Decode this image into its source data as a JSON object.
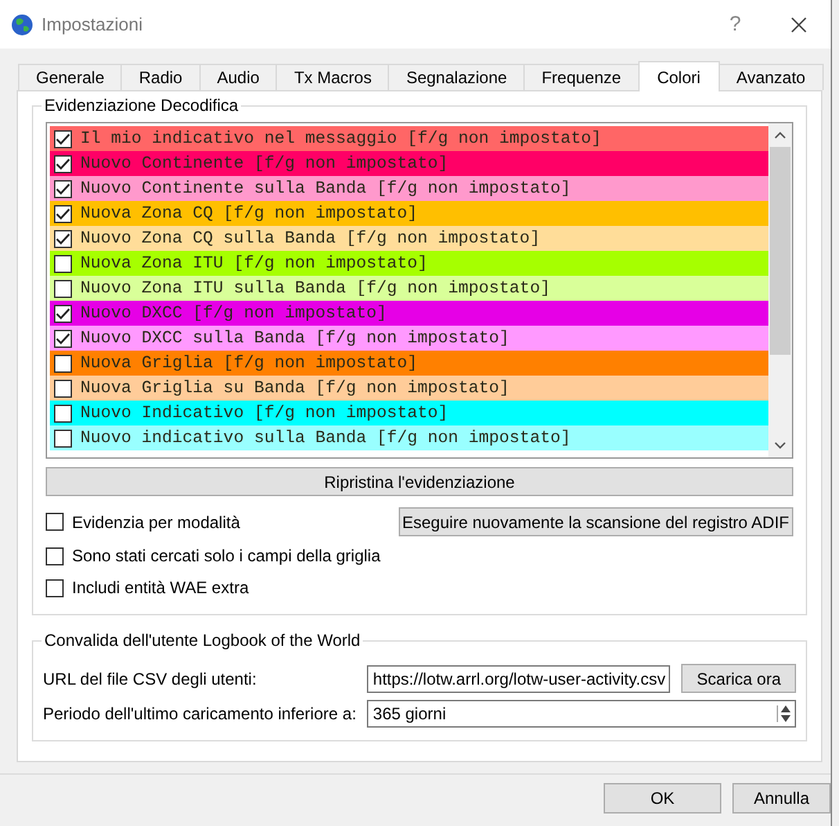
{
  "window": {
    "title": "Impostazioni",
    "help": "?"
  },
  "tabs": [
    {
      "label": "Generale",
      "selected": false
    },
    {
      "label": "Radio",
      "selected": false
    },
    {
      "label": "Audio",
      "selected": false
    },
    {
      "label": "Tx Macros",
      "selected": false
    },
    {
      "label": "Segnalazione",
      "selected": false
    },
    {
      "label": "Frequenze",
      "selected": false
    },
    {
      "label": "Colori",
      "selected": true
    },
    {
      "label": "Avanzato",
      "selected": false
    }
  ],
  "highlight": {
    "title": "Evidenziazione Decodifica",
    "rows": [
      {
        "label": "Il mio indicativo nel messaggio [f/g non impostato]",
        "checked": true,
        "color": "#ff6666"
      },
      {
        "label": "Nuovo Continente [f/g non impostato]",
        "checked": true,
        "color": "#ff0066"
      },
      {
        "label": "Nuovo Continente sulla Banda [f/g non impostato]",
        "checked": true,
        "color": "#ff99cc"
      },
      {
        "label": "Nuova Zona CQ [f/g non impostato]",
        "checked": true,
        "color": "#ffbf00"
      },
      {
        "label": "Nuovo Zona CQ sulla Banda [f/g non impostato]",
        "checked": true,
        "color": "#ffdd99"
      },
      {
        "label": "Nuova Zona ITU [f/g non impostato]",
        "checked": false,
        "color": "#a6ff00"
      },
      {
        "label": "Nuovo Zona ITU sulla Banda [f/g non impostato]",
        "checked": false,
        "color": "#d9ff99"
      },
      {
        "label": "Nuovo DXCC [f/g non impostato]",
        "checked": true,
        "color": "#e600e6"
      },
      {
        "label": "Nuovo DXCC sulla Banda [f/g non impostato]",
        "checked": true,
        "color": "#ff99ff"
      },
      {
        "label": "Nuova Griglia [f/g non impostato]",
        "checked": false,
        "color": "#ff8000"
      },
      {
        "label": "Nuova Griglia su Banda [f/g non impostato]",
        "checked": false,
        "color": "#ffcc99"
      },
      {
        "label": "Nuovo Indicativo [f/g non impostato]",
        "checked": false,
        "color": "#00ffff"
      },
      {
        "label": "Nuovo indicativo sulla Banda [f/g non impostato]",
        "checked": false,
        "color": "#99ffff"
      }
    ],
    "reset_button": "Ripristina l'evidenziazione",
    "options": [
      {
        "label": "Evidenzia per modalità",
        "checked": false
      },
      {
        "label": "Sono stati cercati solo i campi della griglia",
        "checked": false
      },
      {
        "label": "Includi entità WAE extra",
        "checked": false
      }
    ],
    "rescan_button": "Eseguire nuovamente la scansione del registro ADIF"
  },
  "lotw": {
    "title": "Convalida dell'utente Logbook of the World",
    "url_label": "URL del file CSV degli utenti:",
    "url_value": "https://lotw.arrl.org/lotw-user-activity.csv",
    "download_button": "Scarica ora",
    "period_label": "Periodo dell'ultimo caricamento inferiore a:",
    "period_value": "365 giorni"
  },
  "buttons": [
    "OK",
    "Annulla"
  ]
}
